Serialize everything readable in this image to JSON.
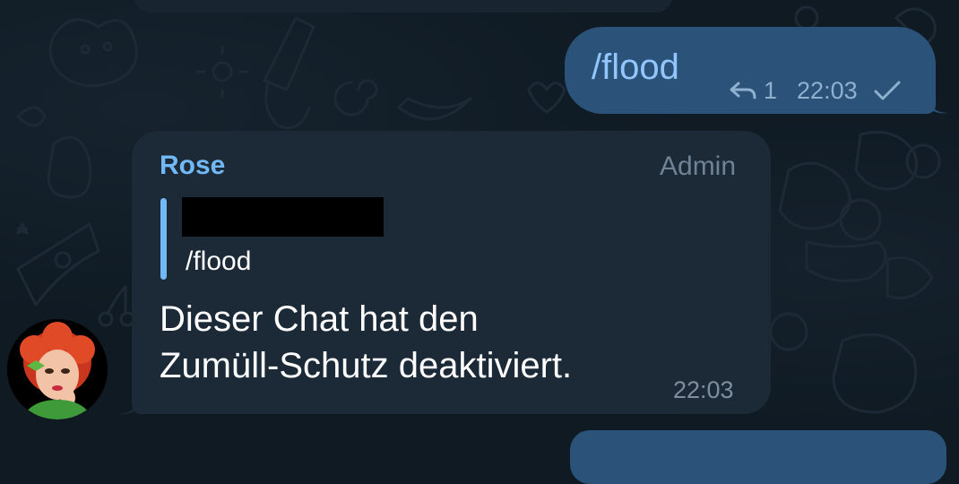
{
  "outgoing_message": {
    "text": "/flood",
    "reply_count": "1",
    "time": "22:03",
    "status_icon": "single-check-icon"
  },
  "incoming_message": {
    "sender": "Rose",
    "badge": "Admin",
    "quoted_text": "/flood",
    "body_line1": "Dieser Chat hat den",
    "body_line2": "Zumüll-Schutz deaktiviert.",
    "time": "22:03"
  },
  "colors": {
    "background": "#0f1a23",
    "outgoing_bubble": "#2b5278",
    "incoming_bubble": "#1c2a37",
    "accent_blue": "#71b8f5",
    "command_link": "#93c6ff"
  }
}
